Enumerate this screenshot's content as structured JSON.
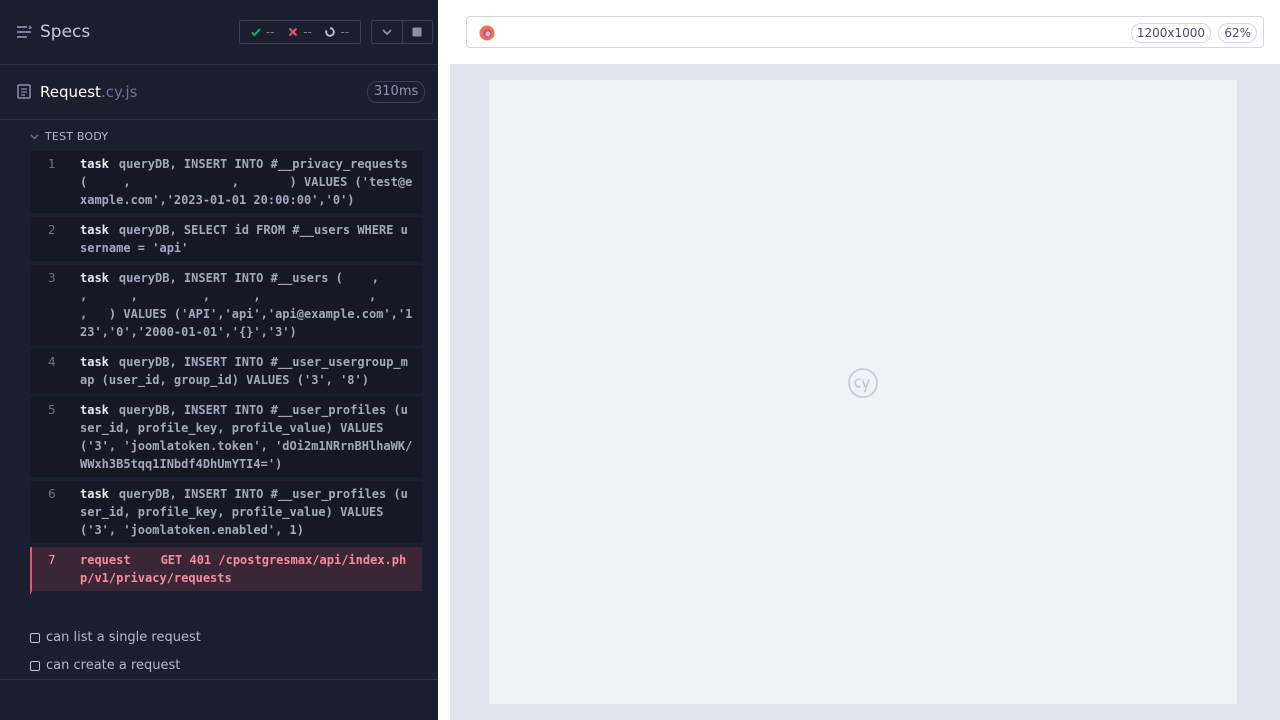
{
  "header": {
    "title": "Specs",
    "stats": {
      "passed": "--",
      "failed": "--",
      "pending": "--"
    }
  },
  "spec_file": {
    "name": "Request",
    "ext": ".cy.js",
    "duration": "310ms"
  },
  "test_body": {
    "label": "TEST BODY",
    "commands": [
      {
        "num": "1",
        "name": "task",
        "message": "queryDB, INSERT INTO #__privacy_requests (     ,              ,       ) VALUES ('test@example.com','2023-01-01 20:00:00','0')",
        "state": "passed"
      },
      {
        "num": "2",
        "name": "task",
        "message": "queryDB, SELECT id FROM #__users WHERE username = 'api'",
        "state": "passed"
      },
      {
        "num": "3",
        "name": "task",
        "message": "queryDB, INSERT INTO #__users (    ,        ,      ,         ,      ,               ,       ,   ) VALUES ('API','api','api@example.com','123','0','2000-01-01','{}','3')",
        "state": "passed"
      },
      {
        "num": "4",
        "name": "task",
        "message": "queryDB, INSERT INTO #__user_usergroup_map (user_id, group_id) VALUES ('3', '8')",
        "state": "passed"
      },
      {
        "num": "5",
        "name": "task",
        "message": "queryDB, INSERT INTO #__user_profiles (user_id, profile_key, profile_value) VALUES ('3', 'joomlatoken.token', 'dOi2m1NRrnBHlhaWK/WWxh3B5tqq1INbdf4DhUmYTI4=')",
        "state": "passed"
      },
      {
        "num": "6",
        "name": "task",
        "message": "queryDB, INSERT INTO #__user_profiles (user_id, profile_key, profile_value) VALUES ('3', 'joomlatoken.enabled', 1)",
        "state": "passed"
      },
      {
        "num": "7",
        "name": "request",
        "message": "GET 401 /cpostgresmax/api/index.php/v1/privacy/requests",
        "state": "failed"
      }
    ]
  },
  "tests": [
    {
      "title": "can list a single request"
    },
    {
      "title": "can create a request"
    }
  ],
  "preview": {
    "viewport": "1200x1000",
    "zoom": "62%"
  },
  "colors": {
    "fail": "#e45770",
    "pass": "#1fa971",
    "panel": "#1b1e2e"
  }
}
